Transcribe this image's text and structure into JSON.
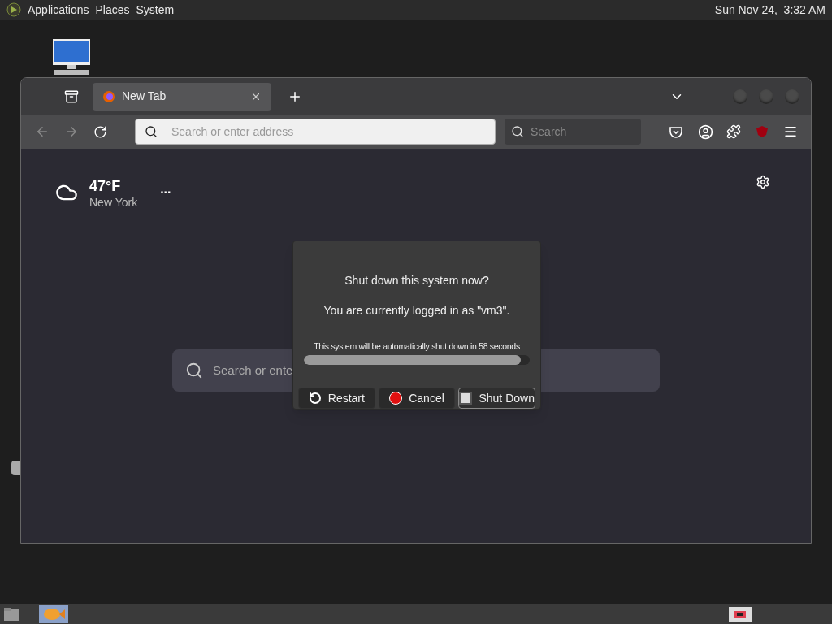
{
  "top_panel": {
    "menus": [
      "Applications",
      "Places",
      "System"
    ],
    "clock": "Sun Nov 24,  3:32 AM"
  },
  "browser": {
    "tabs": [
      {
        "label": "New Tab",
        "selected": true
      }
    ],
    "address_bar": {
      "placeholder": "Search or enter address"
    },
    "search_bar": {
      "placeholder": "Search"
    },
    "weather": {
      "temperature": "47°F",
      "city": "New York",
      "menu": "..."
    },
    "page_search": {
      "placeholder": "Search or ente"
    }
  },
  "dialog": {
    "title": "Shut down this system now?",
    "message": "You are currently logged in as \"vm3\".",
    "countdown": "This system will be automatically shut down in 58 seconds",
    "progress": {
      "level": 0.96
    },
    "buttons": [
      {
        "label": "Restart",
        "kind": "restart",
        "selected": false
      },
      {
        "label": "Cancel",
        "kind": "cancel",
        "selected": false
      },
      {
        "label": "Shut Down",
        "kind": "shutdown",
        "selected": true
      }
    ]
  }
}
